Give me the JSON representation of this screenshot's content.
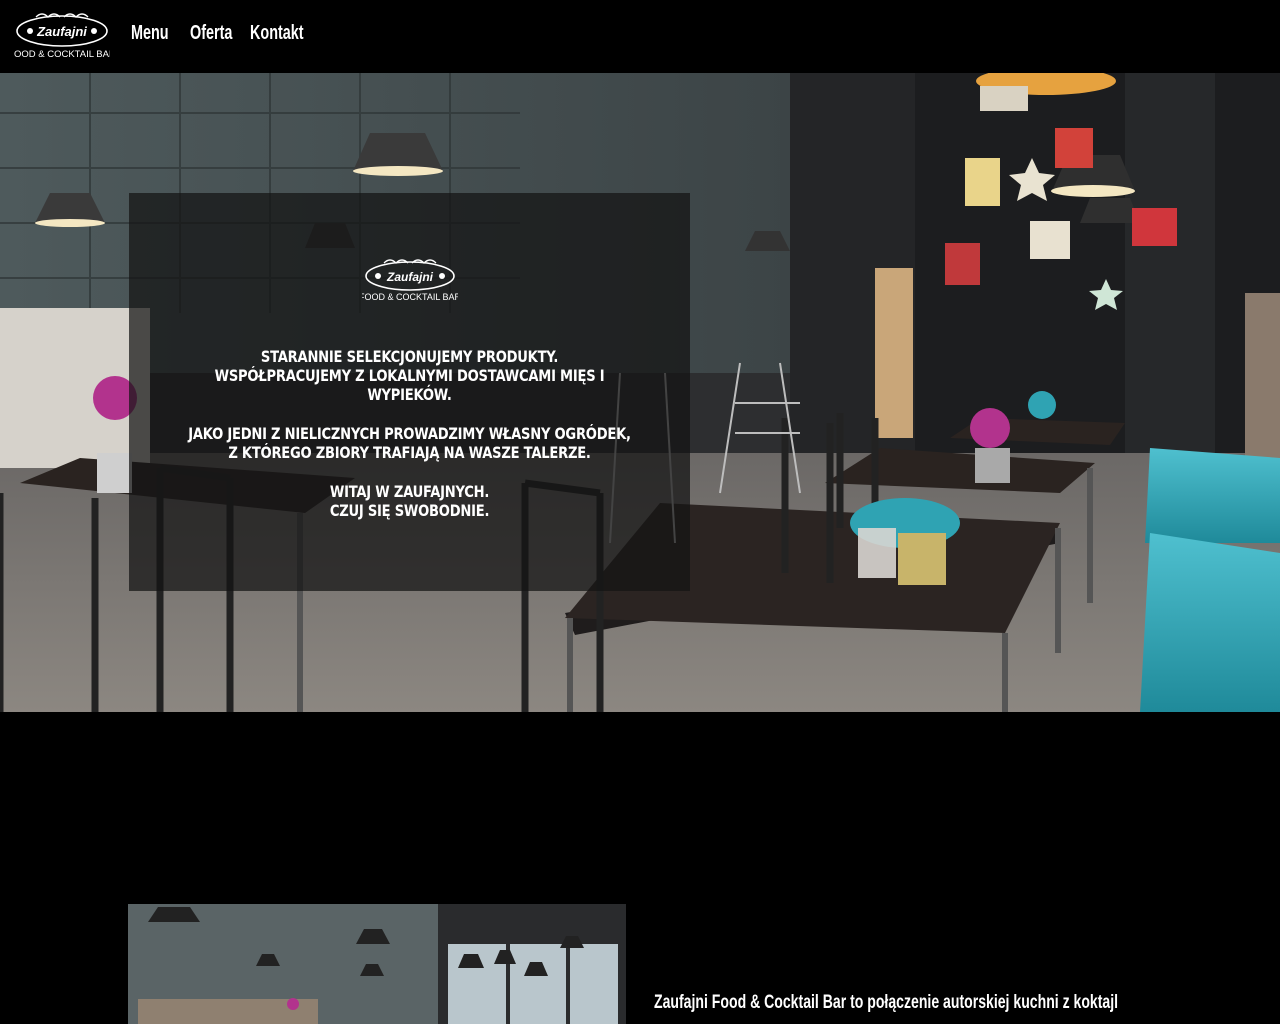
{
  "brand": {
    "logo_name": "Zaufajni",
    "logo_tagline": "FOOD & COCKTAIL BAR"
  },
  "nav": {
    "items": [
      {
        "label": "Menu"
      },
      {
        "label": "Oferta"
      },
      {
        "label": "Kontakt"
      }
    ]
  },
  "hero": {
    "lines": [
      "STARANNIE SELEKCJONUJEMY PRODUKTY.",
      "WSPÓŁPRACUJEMY Z LOKALNYMI DOSTAWCAMI MIĘS I WYPIEKÓW.",
      "JAKO JEDNI Z NIELICZNYCH PROWADZIMY WŁASNY OGRÓDEK,",
      "Z KTÓREGO ZBIORY TRAFIAJĄ NA WASZE TALERZE.",
      "WITAJ W ZAUFAJNYCH.",
      "CZUJ SIĘ SWOBODNIE."
    ]
  },
  "about": {
    "text": "Zaufajni Food & Cocktail Bar to połączenie autorskiej kuchni z koktajl"
  },
  "colors": {
    "background": "#000000",
    "text": "#ffffff",
    "overlay": "#141414",
    "accent_teal": "#2fa3b3"
  }
}
